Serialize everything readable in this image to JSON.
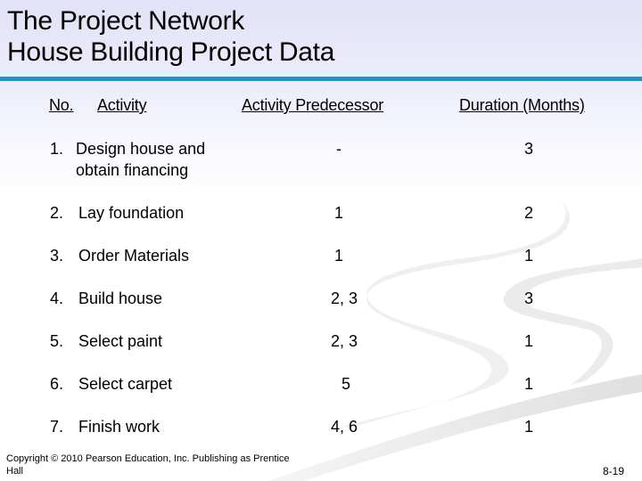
{
  "slide": {
    "title_line1": "The Project Network",
    "title_line2": "House Building Project Data",
    "accent_color": "#1b97c0",
    "headers": {
      "no": "No.",
      "activity": "Activity",
      "predecessor": "Activity Predecessor",
      "duration": "Duration (Months)"
    },
    "rows": [
      {
        "no": "1.",
        "activity_line1": "Design house and",
        "activity_line2": "obtain financing",
        "predecessor": "-",
        "duration": "3"
      },
      {
        "no": "2.",
        "activity_line1": "Lay foundation",
        "activity_line2": "",
        "predecessor": "1",
        "duration": "2"
      },
      {
        "no": "3.",
        "activity_line1": "Order Materials",
        "activity_line2": "",
        "predecessor": "1",
        "duration": "1"
      },
      {
        "no": "4.",
        "activity_line1": "Build house",
        "activity_line2": "",
        "predecessor": "2, 3",
        "duration": "3"
      },
      {
        "no": "5.",
        "activity_line1": "Select paint",
        "activity_line2": "",
        "predecessor": "2, 3",
        "duration": "1"
      },
      {
        "no": "6.",
        "activity_line1": "Select carpet",
        "activity_line2": "",
        "predecessor": "5",
        "duration": "1"
      },
      {
        "no": "7.",
        "activity_line1": "Finish work",
        "activity_line2": "",
        "predecessor": "4, 6",
        "duration": "1"
      }
    ],
    "footer_line1": "Copyright © 2010 Pearson Education, Inc. Publishing as Prentice",
    "footer_line2": "Hall",
    "page_number": "8-19"
  }
}
